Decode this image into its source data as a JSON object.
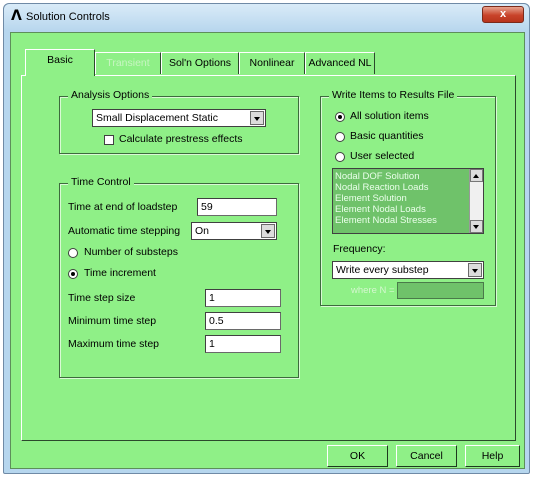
{
  "window": {
    "title": "Solution Controls",
    "close_label": "x"
  },
  "tabs": [
    {
      "label": "Basic",
      "state": "active"
    },
    {
      "label": "Transient",
      "state": "disabled"
    },
    {
      "label": "Sol'n Options",
      "state": "normal"
    },
    {
      "label": "Nonlinear",
      "state": "normal"
    },
    {
      "label": "Advanced NL",
      "state": "normal"
    }
  ],
  "analysis_options": {
    "legend": "Analysis Options",
    "analysis_type": "Small Displacement Static",
    "prestress_label": "Calculate prestress effects",
    "prestress_checked": false
  },
  "time_control": {
    "legend": "Time Control",
    "time_end_label": "Time at end of loadstep",
    "time_end_value": "59",
    "auto_step_label": "Automatic time stepping",
    "auto_step_value": "On",
    "radio_substeps_label": "Number of substeps",
    "radio_increment_label": "Time increment",
    "selected_mode": "Time increment",
    "step_size_label": "Time step size",
    "step_size_value": "1",
    "min_step_label": "Minimum time step",
    "min_step_value": "0.5",
    "max_step_label": "Maximum time step",
    "max_step_value": "1"
  },
  "write_items": {
    "legend": "Write Items to Results File",
    "radio_all": "All solution items",
    "radio_basic": "Basic quantities",
    "radio_user": "User selected",
    "selected": "All solution items",
    "list_items": [
      "Nodal DOF Solution",
      "Nodal Reaction Loads",
      "Element Solution",
      "Element Nodal Loads",
      "Element Nodal Stresses"
    ],
    "frequency_label": "Frequency:",
    "frequency_value": "Write every substep",
    "where_label": "where N ="
  },
  "buttons": {
    "ok": "OK",
    "cancel": "Cancel",
    "help": "Help"
  },
  "colors": {
    "panel": "#8ff087",
    "list_bg": "#6fc26a",
    "titlebar": "#b9d7ee",
    "close": "#c8432a"
  }
}
